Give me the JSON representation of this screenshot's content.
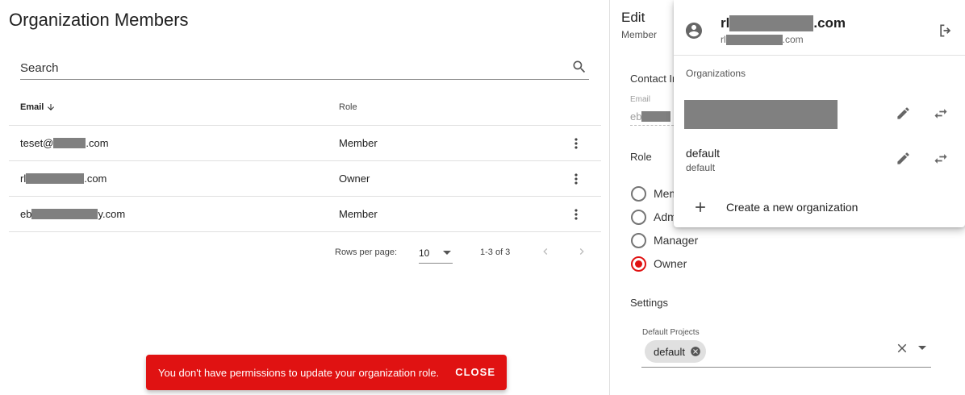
{
  "members_page": {
    "title": "Organization Members",
    "search": {
      "placeholder": "Search"
    },
    "columns": {
      "email": "Email",
      "role": "Role"
    },
    "rows": [
      {
        "email_prefix": "teset@",
        "email_suffix": ".com",
        "role": "Member"
      },
      {
        "email_prefix": "rl",
        "email_suffix": ".com",
        "role": "Owner"
      },
      {
        "email_prefix": "eb",
        "email_suffix": "y.com",
        "role": "Member"
      }
    ],
    "pagination": {
      "rows_per_page_label": "Rows per page:",
      "rows_per_page": "10",
      "range": "1-3 of 3"
    }
  },
  "snackbar": {
    "message": "You don't have permissions to update your organization role.",
    "action": "CLOSE",
    "color": "#e01212"
  },
  "edit_panel": {
    "title": "Edit",
    "subtitle": "Member",
    "contact_heading": "Contact In",
    "email_label": "Email",
    "email_prefix": "eb",
    "role_heading": "Role",
    "roles": [
      {
        "label": "Mem",
        "selected": false
      },
      {
        "label": "Adm",
        "selected": false
      },
      {
        "label": "Manager",
        "selected": false
      },
      {
        "label": "Owner",
        "selected": true
      }
    ],
    "settings_heading": "Settings",
    "default_projects": {
      "label": "Default Projects",
      "chips": [
        "default"
      ]
    }
  },
  "account_menu": {
    "user_name_prefix": "rl",
    "user_name_suffix": ".com",
    "user_email_prefix": "rl",
    "user_email_suffix": ".com",
    "organizations_heading": "Organizations",
    "organizations": [
      {
        "name": "",
        "subtitle": "",
        "redacted": true
      },
      {
        "name": "default",
        "subtitle": "default",
        "redacted": false
      }
    ],
    "create_label": "Create a new organization"
  },
  "icons": [
    "search-icon",
    "arrow-down-icon",
    "more-vert-icon",
    "chevron-left-icon",
    "chevron-right-icon",
    "account-circle-icon",
    "logout-icon",
    "pencil-icon",
    "swap-icon",
    "plus-icon",
    "close-icon",
    "cancel-circle-icon"
  ],
  "colors": {
    "accent": "#e01212",
    "redaction": "#808080"
  }
}
